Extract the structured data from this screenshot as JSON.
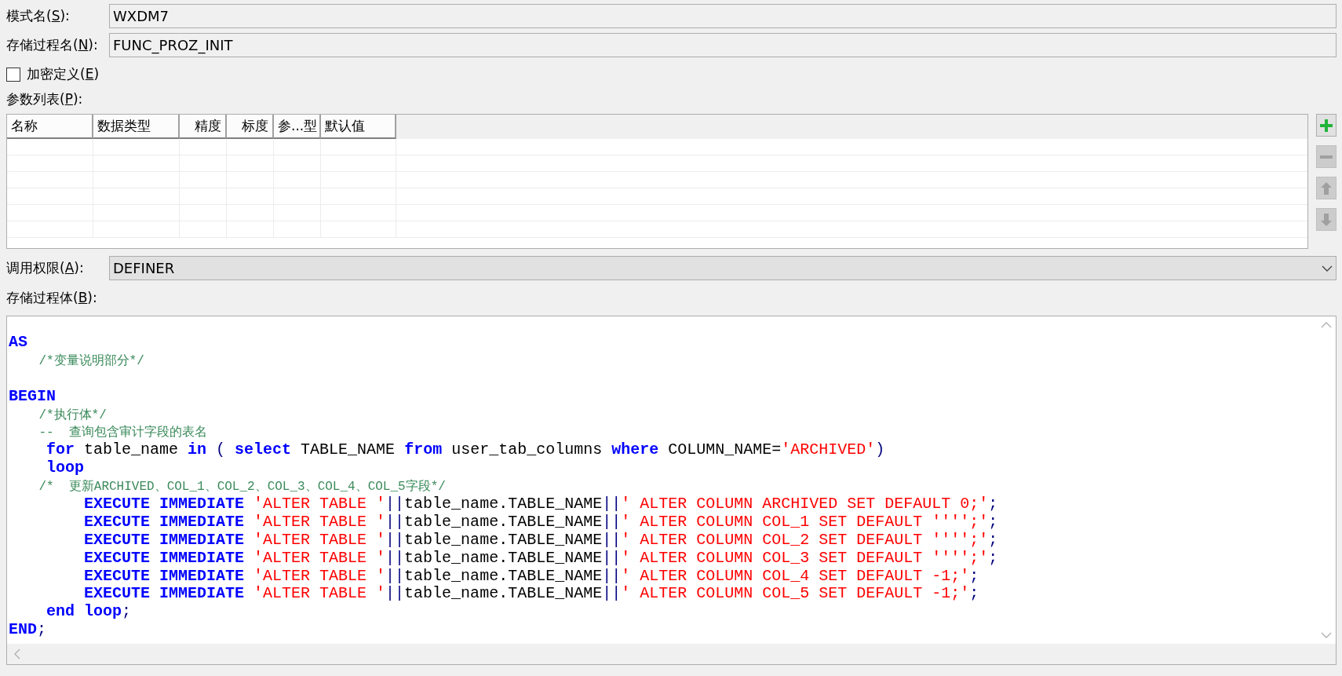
{
  "fields": [
    {
      "label_before": "模式名(",
      "mnemonic": "S",
      "label_after": "):",
      "value": "WXDM7"
    },
    {
      "label_before": "存储过程名(",
      "mnemonic": "N",
      "label_after": "):",
      "value": "FUNC_PROZ_INIT"
    }
  ],
  "encrypt": {
    "label_before": "加密定义(",
    "mnemonic": "E",
    "label_after": ")",
    "checked": false
  },
  "params": {
    "label_before": "参数列表(",
    "mnemonic": "P",
    "label_after": "):",
    "columns": [
      {
        "label": "名称"
      },
      {
        "label": "数据类型"
      },
      {
        "label": "精度"
      },
      {
        "label": "标度"
      },
      {
        "label": "参...型"
      },
      {
        "label": "默认值"
      }
    ],
    "buttons": [
      {
        "kind": "add",
        "disabled": false
      },
      {
        "kind": "remove",
        "disabled": true
      },
      {
        "kind": "up",
        "disabled": true
      },
      {
        "kind": "down",
        "disabled": true
      }
    ]
  },
  "authid": {
    "label_before": "调用权限(",
    "mnemonic": "A",
    "label_after": "):",
    "value": "DEFINER"
  },
  "body": {
    "label_before": "存储过程体(",
    "mnemonic": "B",
    "label_after": "):",
    "lines": [
      {
        "kind": "code",
        "tokens": [
          {
            "kind": "kw",
            "text": "AS"
          }
        ]
      },
      {
        "kind": "code",
        "tokens": [
          {
            "kind": "cmt",
            "text": "    /*变量说明部分*/"
          }
        ]
      },
      {
        "kind": "blank"
      },
      {
        "kind": "code",
        "tokens": [
          {
            "kind": "kw",
            "text": "BEGIN"
          }
        ]
      },
      {
        "kind": "code",
        "tokens": [
          {
            "kind": "cmt",
            "text": "    /*执行体*/"
          }
        ]
      },
      {
        "kind": "code",
        "tokens": [
          {
            "kind": "cmt",
            "text": "    --  查询包含审计字段的表名"
          }
        ]
      },
      {
        "kind": "code",
        "tokens": [
          {
            "kind": "kw",
            "text": "    for"
          },
          {
            "kind": "id",
            "text": " table_name "
          },
          {
            "kind": "kw",
            "text": "in"
          },
          {
            "kind": "op",
            "text": " ( "
          },
          {
            "kind": "kw",
            "text": "select"
          },
          {
            "kind": "id",
            "text": " TABLE_NAME "
          },
          {
            "kind": "kw",
            "text": "from"
          },
          {
            "kind": "id",
            "text": " user_tab_columns "
          },
          {
            "kind": "kw",
            "text": "where"
          },
          {
            "kind": "id",
            "text": " COLUMN_NAME="
          },
          {
            "kind": "str",
            "text": "'ARCHIVED'"
          },
          {
            "kind": "op",
            "text": ")"
          }
        ]
      },
      {
        "kind": "code",
        "tokens": [
          {
            "kind": "kw",
            "text": "    loop"
          }
        ]
      },
      {
        "kind": "code",
        "tokens": [
          {
            "kind": "cmt",
            "text": "    /*  更新ARCHIVED、COL_1、COL_2、COL_3、COL_4、COL_5字段*/"
          }
        ]
      },
      {
        "kind": "code",
        "tokens": [
          {
            "kind": "kw",
            "text": "        EXECUTE IMMEDIATE "
          },
          {
            "kind": "str",
            "text": "'ALTER TABLE '"
          },
          {
            "kind": "op",
            "text": "||"
          },
          {
            "kind": "id",
            "text": "table_name.TABLE_NAME"
          },
          {
            "kind": "op",
            "text": "||"
          },
          {
            "kind": "str",
            "text": "' ALTER COLUMN ARCHIVED SET DEFAULT 0;'"
          },
          {
            "kind": "op",
            "text": ";"
          }
        ]
      },
      {
        "kind": "code",
        "tokens": [
          {
            "kind": "kw",
            "text": "        EXECUTE IMMEDIATE "
          },
          {
            "kind": "str",
            "text": "'ALTER TABLE '"
          },
          {
            "kind": "op",
            "text": "||"
          },
          {
            "kind": "id",
            "text": "table_name.TABLE_NAME"
          },
          {
            "kind": "op",
            "text": "||"
          },
          {
            "kind": "str",
            "text": "' ALTER COLUMN COL_1 SET DEFAULT '''';'"
          },
          {
            "kind": "op",
            "text": ";"
          }
        ]
      },
      {
        "kind": "code",
        "tokens": [
          {
            "kind": "kw",
            "text": "        EXECUTE IMMEDIATE "
          },
          {
            "kind": "str",
            "text": "'ALTER TABLE '"
          },
          {
            "kind": "op",
            "text": "||"
          },
          {
            "kind": "id",
            "text": "table_name.TABLE_NAME"
          },
          {
            "kind": "op",
            "text": "||"
          },
          {
            "kind": "str",
            "text": "' ALTER COLUMN COL_2 SET DEFAULT '''';'"
          },
          {
            "kind": "op",
            "text": ";"
          }
        ]
      },
      {
        "kind": "code",
        "tokens": [
          {
            "kind": "kw",
            "text": "        EXECUTE IMMEDIATE "
          },
          {
            "kind": "str",
            "text": "'ALTER TABLE '"
          },
          {
            "kind": "op",
            "text": "||"
          },
          {
            "kind": "id",
            "text": "table_name.TABLE_NAME"
          },
          {
            "kind": "op",
            "text": "||"
          },
          {
            "kind": "str",
            "text": "' ALTER COLUMN COL_3 SET DEFAULT '''';'"
          },
          {
            "kind": "op",
            "text": ";"
          }
        ]
      },
      {
        "kind": "code",
        "tokens": [
          {
            "kind": "kw",
            "text": "        EXECUTE IMMEDIATE "
          },
          {
            "kind": "str",
            "text": "'ALTER TABLE '"
          },
          {
            "kind": "op",
            "text": "||"
          },
          {
            "kind": "id",
            "text": "table_name.TABLE_NAME"
          },
          {
            "kind": "op",
            "text": "||"
          },
          {
            "kind": "str",
            "text": "' ALTER COLUMN COL_4 SET DEFAULT -1;'"
          },
          {
            "kind": "op",
            "text": ";"
          }
        ]
      },
      {
        "kind": "code",
        "tokens": [
          {
            "kind": "kw",
            "text": "        EXECUTE IMMEDIATE "
          },
          {
            "kind": "str",
            "text": "'ALTER TABLE '"
          },
          {
            "kind": "op",
            "text": "||"
          },
          {
            "kind": "id",
            "text": "table_name.TABLE_NAME"
          },
          {
            "kind": "op",
            "text": "||"
          },
          {
            "kind": "str",
            "text": "' ALTER COLUMN COL_5 SET DEFAULT -1;'"
          },
          {
            "kind": "op",
            "text": ";"
          }
        ]
      },
      {
        "kind": "code",
        "tokens": [
          {
            "kind": "kw",
            "text": "    end loop"
          },
          {
            "kind": "op",
            "text": ";"
          }
        ]
      },
      {
        "kind": "code",
        "tokens": [
          {
            "kind": "kw",
            "text": "END"
          },
          {
            "kind": "op",
            "text": ";"
          }
        ]
      }
    ]
  }
}
